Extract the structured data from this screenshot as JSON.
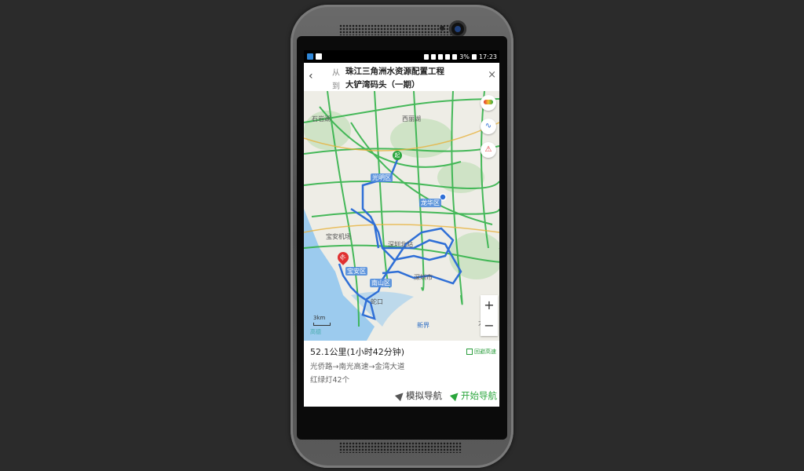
{
  "status_bar": {
    "battery": "3%",
    "time": "17:23"
  },
  "route": {
    "from_label": "从",
    "to_label": "到",
    "from_place": "珠江三角洲水资源配置工程",
    "to_place": "大铲湾码头（一期）",
    "back_icon": "‹",
    "close_icon": "×"
  },
  "map": {
    "labels": {
      "shiyan": "石岩湖",
      "shuiku": "西丽湖",
      "guangming": "光明区",
      "longhua": "龙华区",
      "airport": "宝安机场",
      "shenzhen_north": "深圳北站",
      "baoan": "宝安区",
      "nanshan": "南山区",
      "shenzhen_city": "深圳市",
      "shekou": "蛇口",
      "xinjie": "新界",
      "da": "大"
    },
    "scale_label": "3km",
    "logo_text": "高德",
    "zoom_in": "+",
    "zoom_out": "−",
    "start_marker": "起",
    "end_marker": "终"
  },
  "info": {
    "summary": "52.1公里(1小时42分钟)",
    "avoid_highway": "回避高速",
    "roads": "光侨路→南光高速→金湾大道",
    "traffic_lights": "红绿灯42个",
    "simulate_nav": "模拟导航",
    "start_nav": "开始导航"
  },
  "colors": {
    "route_blue": "#2f6fd6",
    "road_green": "#33b34a",
    "accent_green": "#2aa63c",
    "water": "#9ccbee",
    "land": "#f0efe9"
  }
}
